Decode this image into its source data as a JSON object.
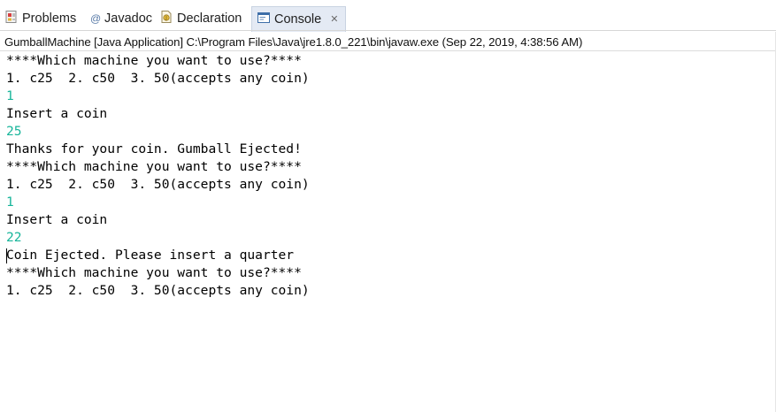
{
  "tabs": [
    {
      "label": "Problems",
      "icon": "problems-icon",
      "active": false
    },
    {
      "label": "Javadoc",
      "icon": "javadoc-icon",
      "active": false
    },
    {
      "label": "Declaration",
      "icon": "declaration-icon",
      "active": false
    },
    {
      "label": "Console",
      "icon": "console-icon",
      "active": true,
      "close": "✕"
    }
  ],
  "console": {
    "description": "GumballMachine [Java Application] C:\\Program Files\\Java\\jre1.8.0_221\\bin\\javaw.exe (Sep 22, 2019, 4:38:56 AM)",
    "lines": [
      {
        "text": "****Which machine you want to use?****",
        "type": "output"
      },
      {
        "text": "1. c25  2. c50  3. 50(accepts any coin)",
        "type": "output"
      },
      {
        "text": "1",
        "type": "input"
      },
      {
        "text": "Insert a coin",
        "type": "output"
      },
      {
        "text": "25",
        "type": "input"
      },
      {
        "text": "Thanks for your coin. Gumball Ejected!",
        "type": "output"
      },
      {
        "text": "****Which machine you want to use?****",
        "type": "output"
      },
      {
        "text": "1. c25  2. c50  3. 50(accepts any coin)",
        "type": "output"
      },
      {
        "text": "1",
        "type": "input"
      },
      {
        "text": "Insert a coin",
        "type": "output"
      },
      {
        "text": "22",
        "type": "input"
      },
      {
        "text": "Coin Ejected. Please insert a quarter",
        "type": "output"
      },
      {
        "text": "****Which machine you want to use?****",
        "type": "output"
      },
      {
        "text": "1. c25  2. c50  3. 50(accepts any coin)",
        "type": "output"
      }
    ],
    "input_color": "#17b59a",
    "output_color": "#000000"
  },
  "colors": {
    "active_tab_bg": "#e4eaf4"
  }
}
